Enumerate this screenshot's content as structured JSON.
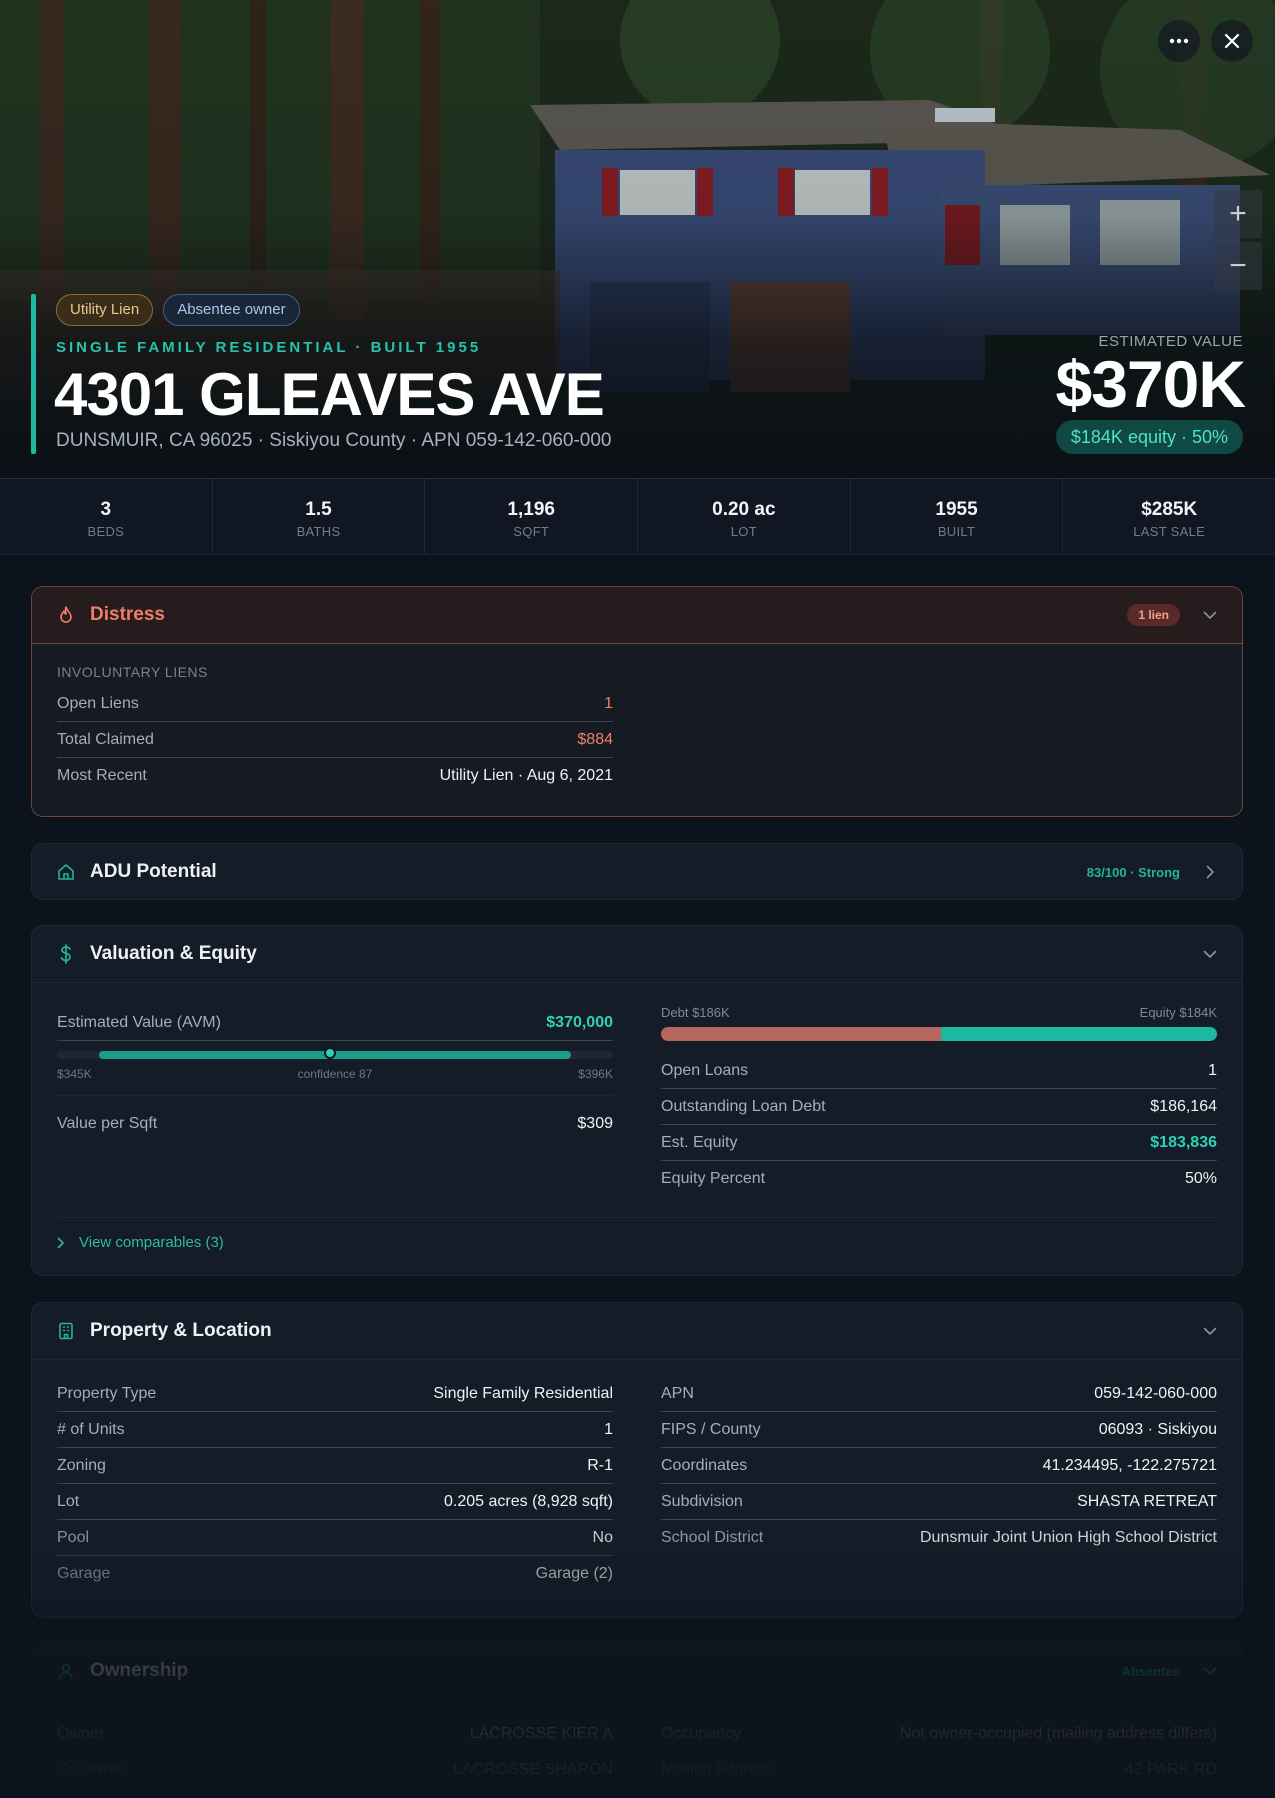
{
  "hero": {
    "tags": [
      "Utility Lien",
      "Absentee owner"
    ],
    "eyebrow": "SINGLE FAMILY RESIDENTIAL · BUILT 1955",
    "address": "4301 GLEAVES AVE",
    "subaddress": "DUNSMUIR, CA 96025 · Siskiyou County · APN 059-142-060-000",
    "estimated_label": "ESTIMATED VALUE",
    "estimated_value": "$370K",
    "equity_pill": "$184K equity · 50%",
    "more_icon": "more-horizontal-icon",
    "close_icon": "close-icon",
    "zoom_in": "+",
    "zoom_out": "−"
  },
  "stats": [
    {
      "value": "3",
      "label": "BEDS"
    },
    {
      "value": "1.5",
      "label": "BATHS"
    },
    {
      "value": "1,196",
      "label": "SQFT"
    },
    {
      "value": "0.20 ac",
      "label": "LOT"
    },
    {
      "value": "1955",
      "label": "BUILT"
    },
    {
      "value": "$285K",
      "label": "LAST SALE"
    }
  ],
  "distress": {
    "title": "Distress",
    "badge": "1 lien",
    "section_label": "INVOLUNTARY LIENS",
    "rows": [
      {
        "k": "Open Liens",
        "v": "1"
      },
      {
        "k": "Total Claimed",
        "v": "$884"
      },
      {
        "k": "Most Recent",
        "v": "Utility Lien · Aug 6, 2021"
      }
    ]
  },
  "adu": {
    "title": "ADU Potential",
    "badge": "83/100 · Strong"
  },
  "valuation": {
    "title": "Valuation & Equity",
    "avm_label": "Estimated Value (AVM)",
    "avm_value": "$370,000",
    "avm_low": "$345K",
    "avm_confidence": "confidence 87",
    "avm_high": "$396K",
    "avm_range_low": 345000,
    "avm_range_high": 396000,
    "avm_estimate": 370000,
    "value_per_sqft_label": "Value per Sqft",
    "value_per_sqft": "$309",
    "debt_label": "Debt $186K",
    "equity_label": "Equity $184K",
    "debt_amount": 186164,
    "equity_amount": 183836,
    "rows": [
      {
        "k": "Open Loans",
        "v": "1"
      },
      {
        "k": "Outstanding Loan Debt",
        "v": "$186,164"
      },
      {
        "k": "Est. Equity",
        "v": "$183,836"
      },
      {
        "k": "Equity Percent",
        "v": "50%"
      }
    ],
    "comparables": "View comparables (3)"
  },
  "property": {
    "title": "Property & Location",
    "left": [
      {
        "k": "Property Type",
        "v": "Single Family Residential"
      },
      {
        "k": "# of Units",
        "v": "1"
      },
      {
        "k": "Zoning",
        "v": "R-1"
      },
      {
        "k": "Lot",
        "v": "0.205 acres (8,928 sqft)"
      },
      {
        "k": "Pool",
        "v": "No"
      },
      {
        "k": "Garage",
        "v": "Garage (2)"
      }
    ],
    "right": [
      {
        "k": "APN",
        "v": "059-142-060-000"
      },
      {
        "k": "FIPS / County",
        "v": "06093 · Siskiyou"
      },
      {
        "k": "Coordinates",
        "v": "41.234495, -122.275721"
      },
      {
        "k": "Subdivision",
        "v": "SHASTA RETREAT"
      },
      {
        "k": "School District",
        "v": "Dunsmuir Joint Union High School District"
      }
    ]
  },
  "ownership": {
    "title": "Ownership",
    "badge": "Absentee",
    "left": [
      {
        "k": "Owner",
        "v": "LACROSSE KIER A"
      },
      {
        "k": "Co-owner",
        "v": "LACROSSE SHARON"
      }
    ],
    "right": [
      {
        "k": "Occupancy",
        "v": "Not owner-occupied (mailing address differs)"
      },
      {
        "k": "Mailing Address",
        "v": "42 PARK RD"
      }
    ]
  }
}
